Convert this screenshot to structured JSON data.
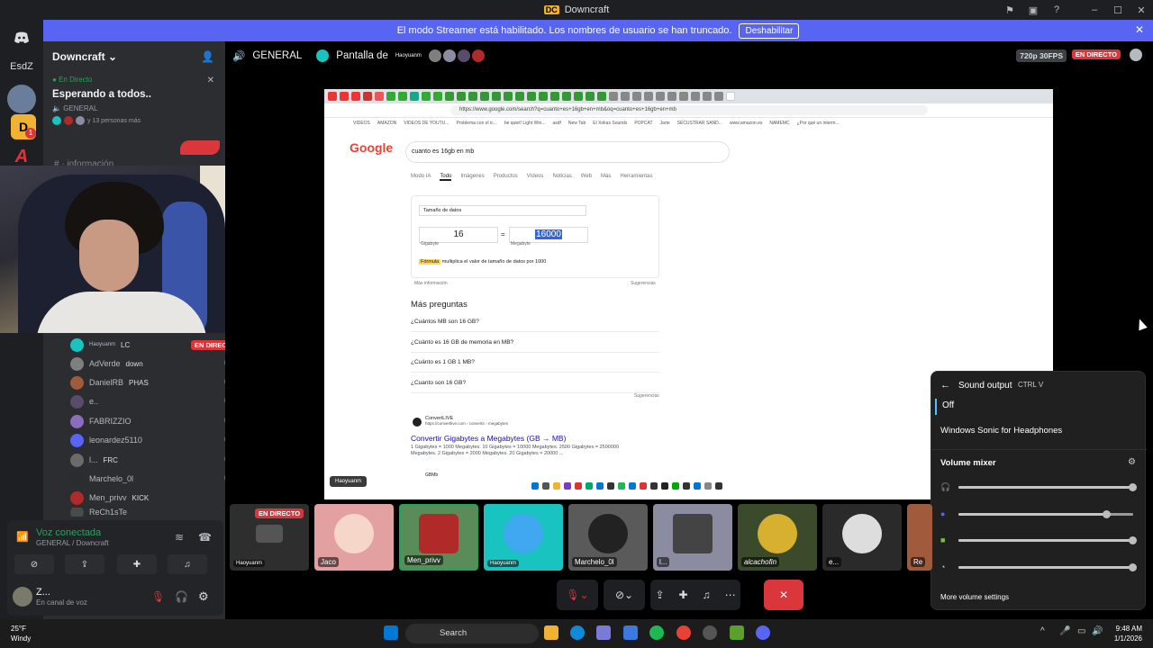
{
  "window": {
    "title": "Downcraft",
    "logo": "DC"
  },
  "banner": {
    "text": "El modo Streamer está habilitado. Los nombres de usuario se han truncado.",
    "button": "Deshabilitar"
  },
  "rail": {
    "top_label": "EsdZ",
    "badge": "1"
  },
  "server": {
    "name": "Downcraft"
  },
  "live_card": {
    "status": "En Directo",
    "title": "Esperando a todos..",
    "channel": "GENERAL",
    "users": "y 13 personas más"
  },
  "channel_faded": "información",
  "stage": {
    "channel": "GENERAL",
    "screen_label": "Pantalla de",
    "screen_user": "Haoyuanm",
    "quality": "720p 30FPS",
    "live": "EN DIRECTO"
  },
  "voice_members": [
    {
      "name": "Haoyuanm",
      "tag": "LC",
      "live": "EN DIRECTO",
      "color": "#19c3c0"
    },
    {
      "name": "AdVerde",
      "tag": "down",
      "color": "#7f7f7f"
    },
    {
      "name": "DanielRB",
      "tag": "PHAS",
      "color": "#a05a3c"
    },
    {
      "name": "e..",
      "tag": "",
      "color": "#5a4a6c"
    },
    {
      "name": "FABRIZZIO",
      "tag": "",
      "color": "#8c6cc0"
    },
    {
      "name": "leonardez5110",
      "tag": "",
      "color": "#5865f2"
    },
    {
      "name": "l...",
      "tag": "FRC",
      "color": "#6b6b6b"
    },
    {
      "name": "Marchelo_0l",
      "tag": "",
      "color": "#2c2c2c"
    },
    {
      "name": "Men_privv",
      "tag": "KICK",
      "color": "#b02a2a"
    },
    {
      "name": "ReCh1sTe",
      "tag": "",
      "color": "#4a4a4a"
    }
  ],
  "voice": {
    "status": "Voz conectada",
    "location": "GENERAL / Downcraft"
  },
  "user": {
    "name": "Z...",
    "status": "En canal de voz"
  },
  "browser": {
    "url": "https://www.google.com/search?q=cuanto+es+16gb+en+mb&oq=cuanto+es+16gb+en+mb",
    "bookmarks": [
      "VIDEOS",
      "AMAZON",
      "VIDEOS DE YOUTU...",
      "Problema con el ic...",
      "be quiet! Light Win...",
      "asdf",
      "New Tab",
      "El Xokas Sounds",
      "POPCAT",
      "Jarte",
      "SECUSTRAR SAND...",
      "www.amazon.es",
      "NAMEMC",
      "¿Por qué un interm..."
    ],
    "google_logo": "Google",
    "query": "cuanto es 16gb en mb",
    "nav": [
      "Modo IA",
      "Todo",
      "Imágenes",
      "Productos",
      "Vídeos",
      "Noticias",
      "Web",
      "Más",
      "Herramientas"
    ],
    "converter": {
      "category": "Tamaño de datos",
      "left_value": "16",
      "right_value": "16000",
      "left_unit": "Gigabyte",
      "right_unit": "Megabyte",
      "formula_label": "Fórmula",
      "formula": "multiplica el valor de tamaño de datos por 1000",
      "more_info": "Más información",
      "feedback": "Sugerencias"
    },
    "more_questions": "Más preguntas",
    "questions": [
      "¿Cuántos MB son 16 GB?",
      "¿Cuánto es 16 GB de memoria en MB?",
      "¿Cuánto es 1 GB 1 MB?",
      "¿Cuanto son 16 GB?"
    ],
    "questions_feedback": "Sugerencias",
    "result": {
      "source": "ConvertLIVE",
      "source_url": "https://convertlive.com › convertir › megabytes",
      "title": "Convertir Gigabytes a Megabytes (GB → MB)",
      "snippet": "1 Gigabytes = 1000 Megabytes. 10 Gigabytes = 10000 Megabytes. 2500 Gigabytes = 2500000 Megabytes. 2 Gigabytes = 2000 Megabytes. 20 Gigabytes = 20000 ...",
      "next": "GBMb"
    },
    "overlay_user": "Haoyuanm"
  },
  "sound": {
    "title": "Sound output",
    "shortcut": "CTRL  V",
    "off": "Off",
    "sonic": "Windows Sonic for Headphones",
    "mixer": "Volume mixer",
    "levels": [
      1.0,
      0.85,
      1.0,
      1.0
    ],
    "more": "More volume settings"
  },
  "tiles": [
    {
      "label": "Haoyuanm",
      "live": "EN DIRECTO",
      "color": "#3a3a3a"
    },
    {
      "label": "Jaco",
      "color": "#e2a0a0"
    },
    {
      "label": "Men_privv",
      "color": "#5a8c5a"
    },
    {
      "label": "Haoyuanm",
      "color": "#19c3c0"
    },
    {
      "label": "Marchelo_0l",
      "color": "#5a5a5a"
    },
    {
      "label": "l...",
      "color": "#8c8ca0"
    },
    {
      "label": "alcachofin",
      "color": "#3a4a2a"
    },
    {
      "label": "e...",
      "color": "#2a2a2a"
    },
    {
      "label": "Re",
      "color": "#a05a3c"
    }
  ],
  "taskbar": {
    "temp": "25°F",
    "weather": "Windy",
    "search": "Search",
    "time": "9:48 AM",
    "date": "1/1/2026"
  }
}
